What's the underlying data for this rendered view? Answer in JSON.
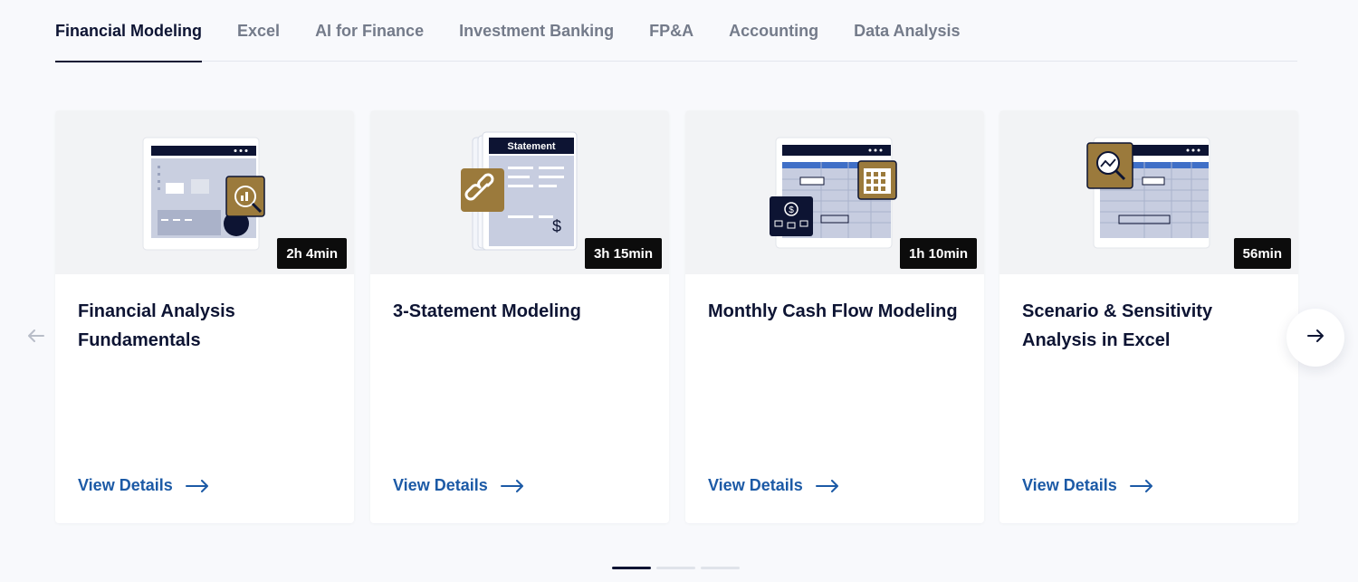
{
  "tabs": [
    {
      "label": "Financial Modeling",
      "active": true
    },
    {
      "label": "Excel"
    },
    {
      "label": "AI for Finance"
    },
    {
      "label": "Investment Banking"
    },
    {
      "label": "FP&A"
    },
    {
      "label": "Accounting"
    },
    {
      "label": "Data Analysis"
    }
  ],
  "cards": [
    {
      "title": "Financial Analysis Fundamentals",
      "duration": "2h 4min",
      "link": "View Details"
    },
    {
      "title": "3-Statement Modeling",
      "duration": "3h 15min",
      "link": "View Details",
      "thumb_heading": "Statement"
    },
    {
      "title": "Monthly Cash Flow Modeling",
      "duration": "1h 10min",
      "link": "View Details"
    },
    {
      "title": "Scenario & Sensitivity Analysis in Excel",
      "duration": "56min",
      "link": "View Details"
    }
  ],
  "icons": {
    "prev": "arrow-left-icon",
    "next": "arrow-right-icon",
    "link": "arrow-right-icon"
  },
  "colors": {
    "navy": "#0d1433",
    "gold": "#9b7a3c",
    "link": "#1c5aa6",
    "badge": "#0c0c0c"
  },
  "pagination": {
    "pages": 3,
    "current": 1
  }
}
